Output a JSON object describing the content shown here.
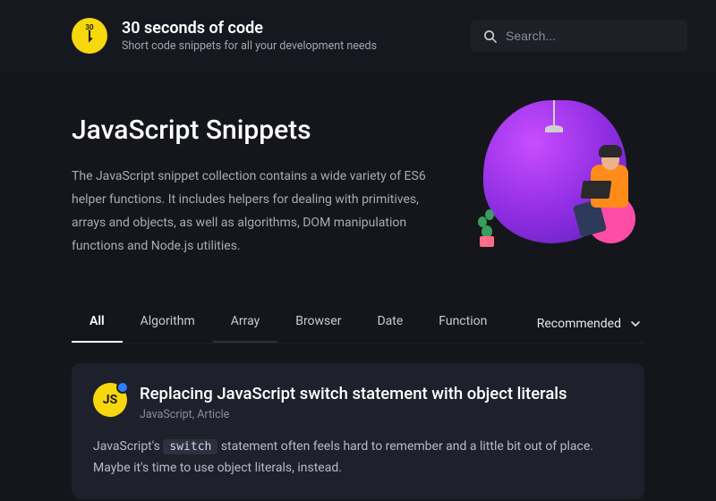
{
  "header": {
    "logo_num": "30",
    "brand_title": "30 seconds of code",
    "brand_sub": "Short code snippets for all your development needs",
    "search_placeholder": "Search..."
  },
  "hero": {
    "title": "JavaScript Snippets",
    "description": "The JavaScript snippet collection contains a wide variety of ES6 helper functions. It includes helpers for dealing with primitives, arrays and objects, as well as algorithms, DOM manipulation functions and Node.js utilities."
  },
  "tabs": [
    {
      "label": "All",
      "active": true
    },
    {
      "label": "Algorithm",
      "active": false
    },
    {
      "label": "Array",
      "active": false
    },
    {
      "label": "Browser",
      "active": false
    },
    {
      "label": "Date",
      "active": false
    },
    {
      "label": "Function",
      "active": false
    }
  ],
  "sort": {
    "label": "Recommended"
  },
  "card": {
    "badge": "JS",
    "title": "Replacing JavaScript switch statement with object literals",
    "meta": "JavaScript, Article",
    "body_pre": "JavaScript's ",
    "body_code": "switch",
    "body_post": " statement often feels hard to remember and a little bit out of place. Maybe it's time to use object literals, instead."
  }
}
